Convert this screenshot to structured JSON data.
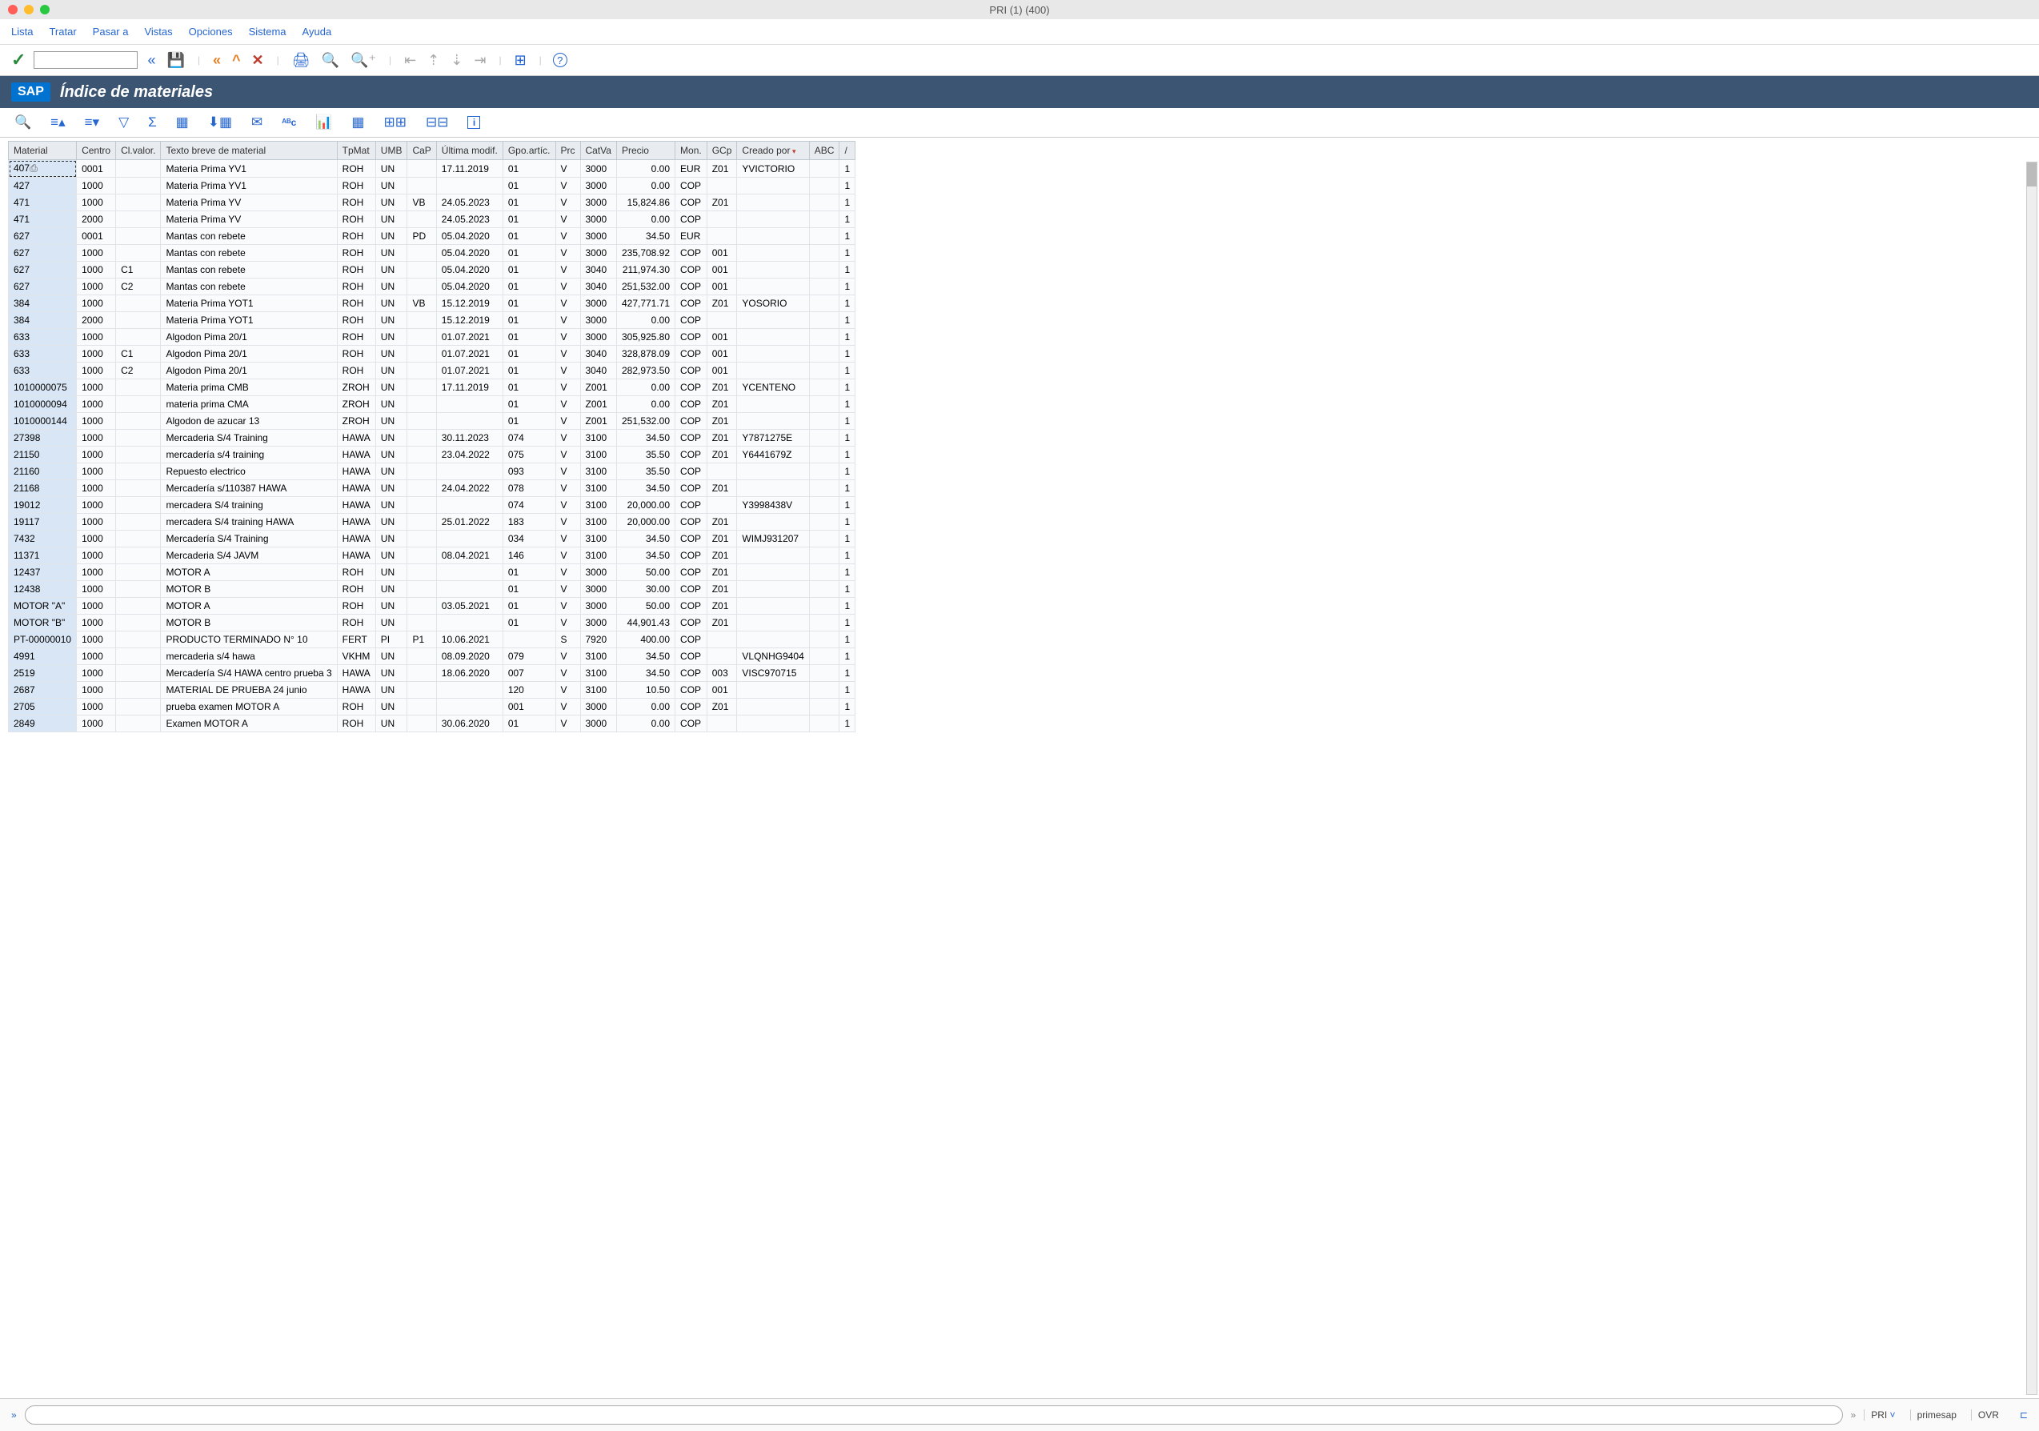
{
  "window_title": "PRI (1) (400)",
  "menu": [
    "Lista",
    "Tratar",
    "Pasar a",
    "Vistas",
    "Opciones",
    "Sistema",
    "Ayuda"
  ],
  "page_title": "Índice de materiales",
  "columns": [
    "Material",
    "Centro",
    "Cl.valor.",
    "Texto breve de material",
    "TpMat",
    "UMB",
    "CaP",
    "Última modif.",
    "Gpo.artíc.",
    "Prc",
    "CatVa",
    "Precio",
    "Mon.",
    "GCp",
    "Creado por",
    "ABC",
    "/"
  ],
  "rows": [
    {
      "material": "407",
      "centro": "0001",
      "clvalor": "",
      "texto": "Materia Prima YV1",
      "tpmat": "ROH",
      "umb": "UN",
      "cap": "",
      "modif": "17.11.2019",
      "gpo": "01",
      "prc": "V",
      "catva": "3000",
      "precio": "0.00",
      "mon": "EUR",
      "gcp": "Z01",
      "creado": "YVICTORIO",
      "abc": "",
      "slash": "1"
    },
    {
      "material": "427",
      "centro": "1000",
      "clvalor": "",
      "texto": "Materia Prima YV1",
      "tpmat": "ROH",
      "umb": "UN",
      "cap": "",
      "modif": "",
      "gpo": "01",
      "prc": "V",
      "catva": "3000",
      "precio": "0.00",
      "mon": "COP",
      "gcp": "",
      "creado": "",
      "abc": "",
      "slash": "1"
    },
    {
      "material": "471",
      "centro": "1000",
      "clvalor": "",
      "texto": "Materia Prima YV",
      "tpmat": "ROH",
      "umb": "UN",
      "cap": "VB",
      "modif": "24.05.2023",
      "gpo": "01",
      "prc": "V",
      "catva": "3000",
      "precio": "15,824.86",
      "mon": "COP",
      "gcp": "Z01",
      "creado": "",
      "abc": "",
      "slash": "1"
    },
    {
      "material": "471",
      "centro": "2000",
      "clvalor": "",
      "texto": "Materia Prima YV",
      "tpmat": "ROH",
      "umb": "UN",
      "cap": "",
      "modif": "24.05.2023",
      "gpo": "01",
      "prc": "V",
      "catva": "3000",
      "precio": "0.00",
      "mon": "COP",
      "gcp": "",
      "creado": "",
      "abc": "",
      "slash": "1"
    },
    {
      "material": "627",
      "centro": "0001",
      "clvalor": "",
      "texto": "Mantas con rebete",
      "tpmat": "ROH",
      "umb": "UN",
      "cap": "PD",
      "modif": "05.04.2020",
      "gpo": "01",
      "prc": "V",
      "catva": "3000",
      "precio": "34.50",
      "mon": "EUR",
      "gcp": "",
      "creado": "",
      "abc": "",
      "slash": "1"
    },
    {
      "material": "627",
      "centro": "1000",
      "clvalor": "",
      "texto": "Mantas con rebete",
      "tpmat": "ROH",
      "umb": "UN",
      "cap": "",
      "modif": "05.04.2020",
      "gpo": "01",
      "prc": "V",
      "catva": "3000",
      "precio": "235,708.92",
      "mon": "COP",
      "gcp": "001",
      "creado": "",
      "abc": "",
      "slash": "1"
    },
    {
      "material": "627",
      "centro": "1000",
      "clvalor": "C1",
      "texto": "Mantas con rebete",
      "tpmat": "ROH",
      "umb": "UN",
      "cap": "",
      "modif": "05.04.2020",
      "gpo": "01",
      "prc": "V",
      "catva": "3040",
      "precio": "211,974.30",
      "mon": "COP",
      "gcp": "001",
      "creado": "",
      "abc": "",
      "slash": "1"
    },
    {
      "material": "627",
      "centro": "1000",
      "clvalor": "C2",
      "texto": "Mantas con rebete",
      "tpmat": "ROH",
      "umb": "UN",
      "cap": "",
      "modif": "05.04.2020",
      "gpo": "01",
      "prc": "V",
      "catva": "3040",
      "precio": "251,532.00",
      "mon": "COP",
      "gcp": "001",
      "creado": "",
      "abc": "",
      "slash": "1"
    },
    {
      "material": "384",
      "centro": "1000",
      "clvalor": "",
      "texto": "Materia Prima YOT1",
      "tpmat": "ROH",
      "umb": "UN",
      "cap": "VB",
      "modif": "15.12.2019",
      "gpo": "01",
      "prc": "V",
      "catva": "3000",
      "precio": "427,771.71",
      "mon": "COP",
      "gcp": "Z01",
      "creado": "YOSORIO",
      "abc": "",
      "slash": "1"
    },
    {
      "material": "384",
      "centro": "2000",
      "clvalor": "",
      "texto": "Materia Prima YOT1",
      "tpmat": "ROH",
      "umb": "UN",
      "cap": "",
      "modif": "15.12.2019",
      "gpo": "01",
      "prc": "V",
      "catva": "3000",
      "precio": "0.00",
      "mon": "COP",
      "gcp": "",
      "creado": "",
      "abc": "",
      "slash": "1"
    },
    {
      "material": "633",
      "centro": "1000",
      "clvalor": "",
      "texto": "Algodon Pima 20/1",
      "tpmat": "ROH",
      "umb": "UN",
      "cap": "",
      "modif": "01.07.2021",
      "gpo": "01",
      "prc": "V",
      "catva": "3000",
      "precio": "305,925.80",
      "mon": "COP",
      "gcp": "001",
      "creado": "",
      "abc": "",
      "slash": "1"
    },
    {
      "material": "633",
      "centro": "1000",
      "clvalor": "C1",
      "texto": "Algodon Pima 20/1",
      "tpmat": "ROH",
      "umb": "UN",
      "cap": "",
      "modif": "01.07.2021",
      "gpo": "01",
      "prc": "V",
      "catva": "3040",
      "precio": "328,878.09",
      "mon": "COP",
      "gcp": "001",
      "creado": "",
      "abc": "",
      "slash": "1"
    },
    {
      "material": "633",
      "centro": "1000",
      "clvalor": "C2",
      "texto": "Algodon Pima 20/1",
      "tpmat": "ROH",
      "umb": "UN",
      "cap": "",
      "modif": "01.07.2021",
      "gpo": "01",
      "prc": "V",
      "catva": "3040",
      "precio": "282,973.50",
      "mon": "COP",
      "gcp": "001",
      "creado": "",
      "abc": "",
      "slash": "1"
    },
    {
      "material": "1010000075",
      "centro": "1000",
      "clvalor": "",
      "texto": "Materia prima CMB",
      "tpmat": "ZROH",
      "umb": "UN",
      "cap": "",
      "modif": "17.11.2019",
      "gpo": "01",
      "prc": "V",
      "catva": "Z001",
      "precio": "0.00",
      "mon": "COP",
      "gcp": "Z01",
      "creado": "YCENTENO",
      "abc": "",
      "slash": "1"
    },
    {
      "material": "1010000094",
      "centro": "1000",
      "clvalor": "",
      "texto": "materia prima CMA",
      "tpmat": "ZROH",
      "umb": "UN",
      "cap": "",
      "modif": "",
      "gpo": "01",
      "prc": "V",
      "catva": "Z001",
      "precio": "0.00",
      "mon": "COP",
      "gcp": "Z01",
      "creado": "",
      "abc": "",
      "slash": "1"
    },
    {
      "material": "1010000144",
      "centro": "1000",
      "clvalor": "",
      "texto": "Algodon  de azucar 13",
      "tpmat": "ZROH",
      "umb": "UN",
      "cap": "",
      "modif": "",
      "gpo": "01",
      "prc": "V",
      "catva": "Z001",
      "precio": "251,532.00",
      "mon": "COP",
      "gcp": "Z01",
      "creado": "",
      "abc": "",
      "slash": "1"
    },
    {
      "material": "27398",
      "centro": "1000",
      "clvalor": "",
      "texto": "Mercaderia S/4 Training",
      "tpmat": "HAWA",
      "umb": "UN",
      "cap": "",
      "modif": "30.11.2023",
      "gpo": "074",
      "prc": "V",
      "catva": "3100",
      "precio": "34.50",
      "mon": "COP",
      "gcp": "Z01",
      "creado": "Y7871275E",
      "abc": "",
      "slash": "1"
    },
    {
      "material": "21150",
      "centro": "1000",
      "clvalor": "",
      "texto": "mercadería s/4 training",
      "tpmat": "HAWA",
      "umb": "UN",
      "cap": "",
      "modif": "23.04.2022",
      "gpo": "075",
      "prc": "V",
      "catva": "3100",
      "precio": "35.50",
      "mon": "COP",
      "gcp": "Z01",
      "creado": "Y6441679Z",
      "abc": "",
      "slash": "1"
    },
    {
      "material": "21160",
      "centro": "1000",
      "clvalor": "",
      "texto": "Repuesto electrico",
      "tpmat": "HAWA",
      "umb": "UN",
      "cap": "",
      "modif": "",
      "gpo": "093",
      "prc": "V",
      "catva": "3100",
      "precio": "35.50",
      "mon": "COP",
      "gcp": "",
      "creado": "",
      "abc": "",
      "slash": "1"
    },
    {
      "material": "21168",
      "centro": "1000",
      "clvalor": "",
      "texto": "Mercadería s/110387 HAWA",
      "tpmat": "HAWA",
      "umb": "UN",
      "cap": "",
      "modif": "24.04.2022",
      "gpo": "078",
      "prc": "V",
      "catva": "3100",
      "precio": "34.50",
      "mon": "COP",
      "gcp": "Z01",
      "creado": "",
      "abc": "",
      "slash": "1"
    },
    {
      "material": "19012",
      "centro": "1000",
      "clvalor": "",
      "texto": "mercadera S/4 training",
      "tpmat": "HAWA",
      "umb": "UN",
      "cap": "",
      "modif": "",
      "gpo": "074",
      "prc": "V",
      "catva": "3100",
      "precio": "20,000.00",
      "mon": "COP",
      "gcp": "",
      "creado": "Y3998438V",
      "abc": "",
      "slash": "1"
    },
    {
      "material": "19117",
      "centro": "1000",
      "clvalor": "",
      "texto": "mercadera S/4 training HAWA",
      "tpmat": "HAWA",
      "umb": "UN",
      "cap": "",
      "modif": "25.01.2022",
      "gpo": "183",
      "prc": "V",
      "catva": "3100",
      "precio": "20,000.00",
      "mon": "COP",
      "gcp": "Z01",
      "creado": "",
      "abc": "",
      "slash": "1"
    },
    {
      "material": "7432",
      "centro": "1000",
      "clvalor": "",
      "texto": "Mercadería S/4 Training",
      "tpmat": "HAWA",
      "umb": "UN",
      "cap": "",
      "modif": "",
      "gpo": "034",
      "prc": "V",
      "catva": "3100",
      "precio": "34.50",
      "mon": "COP",
      "gcp": "Z01",
      "creado": "WIMJ931207",
      "abc": "",
      "slash": "1"
    },
    {
      "material": "11371",
      "centro": "1000",
      "clvalor": "",
      "texto": "Mercaderia S/4 JAVM",
      "tpmat": "HAWA",
      "umb": "UN",
      "cap": "",
      "modif": "08.04.2021",
      "gpo": "146",
      "prc": "V",
      "catva": "3100",
      "precio": "34.50",
      "mon": "COP",
      "gcp": "Z01",
      "creado": "",
      "abc": "",
      "slash": "1"
    },
    {
      "material": "12437",
      "centro": "1000",
      "clvalor": "",
      "texto": "MOTOR A",
      "tpmat": "ROH",
      "umb": "UN",
      "cap": "",
      "modif": "",
      "gpo": "01",
      "prc": "V",
      "catva": "3000",
      "precio": "50.00",
      "mon": "COP",
      "gcp": "Z01",
      "creado": "",
      "abc": "",
      "slash": "1"
    },
    {
      "material": "12438",
      "centro": "1000",
      "clvalor": "",
      "texto": "MOTOR B",
      "tpmat": "ROH",
      "umb": "UN",
      "cap": "",
      "modif": "",
      "gpo": "01",
      "prc": "V",
      "catva": "3000",
      "precio": "30.00",
      "mon": "COP",
      "gcp": "Z01",
      "creado": "",
      "abc": "",
      "slash": "1"
    },
    {
      "material": "MOTOR \"A\"",
      "centro": "1000",
      "clvalor": "",
      "texto": "MOTOR A",
      "tpmat": "ROH",
      "umb": "UN",
      "cap": "",
      "modif": "03.05.2021",
      "gpo": "01",
      "prc": "V",
      "catva": "3000",
      "precio": "50.00",
      "mon": "COP",
      "gcp": "Z01",
      "creado": "",
      "abc": "",
      "slash": "1"
    },
    {
      "material": "MOTOR \"B\"",
      "centro": "1000",
      "clvalor": "",
      "texto": "MOTOR B",
      "tpmat": "ROH",
      "umb": "UN",
      "cap": "",
      "modif": "",
      "gpo": "01",
      "prc": "V",
      "catva": "3000",
      "precio": "44,901.43",
      "mon": "COP",
      "gcp": "Z01",
      "creado": "",
      "abc": "",
      "slash": "1"
    },
    {
      "material": "PT-00000010",
      "centro": "1000",
      "clvalor": "",
      "texto": "PRODUCTO TERMINADO N° 10",
      "tpmat": "FERT",
      "umb": "PI",
      "cap": "P1",
      "modif": "10.06.2021",
      "gpo": "",
      "prc": "S",
      "catva": "7920",
      "precio": "400.00",
      "mon": "COP",
      "gcp": "",
      "creado": "",
      "abc": "",
      "slash": "1"
    },
    {
      "material": "4991",
      "centro": "1000",
      "clvalor": "",
      "texto": "mercaderia s/4 hawa",
      "tpmat": "VKHM",
      "umb": "UN",
      "cap": "",
      "modif": "08.09.2020",
      "gpo": "079",
      "prc": "V",
      "catva": "3100",
      "precio": "34.50",
      "mon": "COP",
      "gcp": "",
      "creado": "VLQNHG9404",
      "abc": "",
      "slash": "1"
    },
    {
      "material": "2519",
      "centro": "1000",
      "clvalor": "",
      "texto": "Mercadería S/4 HAWA centro prueba 3",
      "tpmat": "HAWA",
      "umb": "UN",
      "cap": "",
      "modif": "18.06.2020",
      "gpo": "007",
      "prc": "V",
      "catva": "3100",
      "precio": "34.50",
      "mon": "COP",
      "gcp": "003",
      "creado": "VISC970715",
      "abc": "",
      "slash": "1"
    },
    {
      "material": "2687",
      "centro": "1000",
      "clvalor": "",
      "texto": "MATERIAL DE PRUEBA 24 junio",
      "tpmat": "HAWA",
      "umb": "UN",
      "cap": "",
      "modif": "",
      "gpo": "120",
      "prc": "V",
      "catva": "3100",
      "precio": "10.50",
      "mon": "COP",
      "gcp": "001",
      "creado": "",
      "abc": "",
      "slash": "1"
    },
    {
      "material": "2705",
      "centro": "1000",
      "clvalor": "",
      "texto": "prueba examen MOTOR A",
      "tpmat": "ROH",
      "umb": "UN",
      "cap": "",
      "modif": "",
      "gpo": "001",
      "prc": "V",
      "catva": "3000",
      "precio": "0.00",
      "mon": "COP",
      "gcp": "Z01",
      "creado": "",
      "abc": "",
      "slash": "1"
    },
    {
      "material": "2849",
      "centro": "1000",
      "clvalor": "",
      "texto": "Examen MOTOR A",
      "tpmat": "ROH",
      "umb": "UN",
      "cap": "",
      "modif": "30.06.2020",
      "gpo": "01",
      "prc": "V",
      "catva": "3000",
      "precio": "0.00",
      "mon": "COP",
      "gcp": "",
      "creado": "",
      "abc": "",
      "slash": "1"
    }
  ],
  "status": {
    "system": "PRI",
    "server": "primesap",
    "mode": "OVR"
  }
}
